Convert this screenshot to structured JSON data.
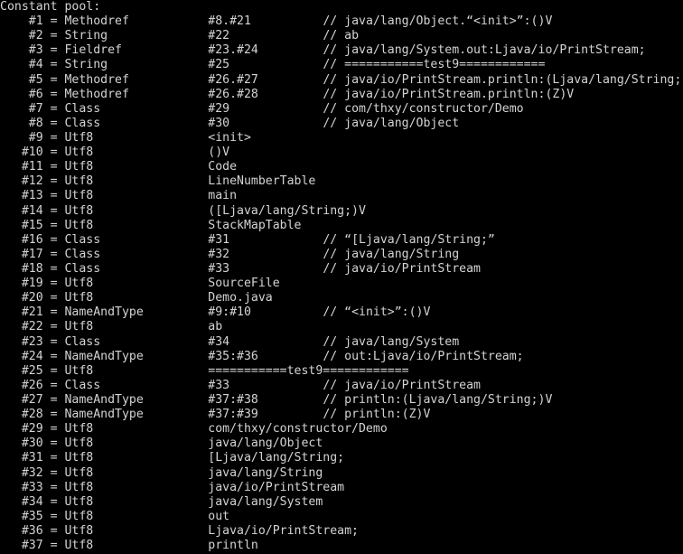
{
  "terminal": {
    "title": "Constant pool:",
    "background_color": "#000000",
    "text_color": "#d4d4d4",
    "columns": {
      "index_width": 6,
      "type_start": 9,
      "value_start": 29,
      "comment_start": 45
    }
  },
  "constant_pool": {
    "heading": "Constant pool:",
    "entries": [
      {
        "index": "#1",
        "eq": "=",
        "type": "Methodref",
        "value": "#8.#21",
        "comment": "// java/lang/Object.“<init>”:()V"
      },
      {
        "index": "#2",
        "eq": "=",
        "type": "String",
        "value": "#22",
        "comment": "// ab"
      },
      {
        "index": "#3",
        "eq": "=",
        "type": "Fieldref",
        "value": "#23.#24",
        "comment": "// java/lang/System.out:Ljava/io/PrintStream;"
      },
      {
        "index": "#4",
        "eq": "=",
        "type": "String",
        "value": "#25",
        "comment": "// ===========test9============"
      },
      {
        "index": "#5",
        "eq": "=",
        "type": "Methodref",
        "value": "#26.#27",
        "comment": "// java/io/PrintStream.println:(Ljava/lang/String;)V"
      },
      {
        "index": "#6",
        "eq": "=",
        "type": "Methodref",
        "value": "#26.#28",
        "comment": "// java/io/PrintStream.println:(Z)V"
      },
      {
        "index": "#7",
        "eq": "=",
        "type": "Class",
        "value": "#29",
        "comment": "// com/thxy/constructor/Demo"
      },
      {
        "index": "#8",
        "eq": "=",
        "type": "Class",
        "value": "#30",
        "comment": "// java/lang/Object"
      },
      {
        "index": "#9",
        "eq": "=",
        "type": "Utf8",
        "value": "<init>",
        "comment": ""
      },
      {
        "index": "#10",
        "eq": "=",
        "type": "Utf8",
        "value": "()V",
        "comment": ""
      },
      {
        "index": "#11",
        "eq": "=",
        "type": "Utf8",
        "value": "Code",
        "comment": ""
      },
      {
        "index": "#12",
        "eq": "=",
        "type": "Utf8",
        "value": "LineNumberTable",
        "comment": ""
      },
      {
        "index": "#13",
        "eq": "=",
        "type": "Utf8",
        "value": "main",
        "comment": ""
      },
      {
        "index": "#14",
        "eq": "=",
        "type": "Utf8",
        "value": "([Ljava/lang/String;)V",
        "comment": ""
      },
      {
        "index": "#15",
        "eq": "=",
        "type": "Utf8",
        "value": "StackMapTable",
        "comment": ""
      },
      {
        "index": "#16",
        "eq": "=",
        "type": "Class",
        "value": "#31",
        "comment": "// “[Ljava/lang/String;”"
      },
      {
        "index": "#17",
        "eq": "=",
        "type": "Class",
        "value": "#32",
        "comment": "// java/lang/String"
      },
      {
        "index": "#18",
        "eq": "=",
        "type": "Class",
        "value": "#33",
        "comment": "// java/io/PrintStream"
      },
      {
        "index": "#19",
        "eq": "=",
        "type": "Utf8",
        "value": "SourceFile",
        "comment": ""
      },
      {
        "index": "#20",
        "eq": "=",
        "type": "Utf8",
        "value": "Demo.java",
        "comment": ""
      },
      {
        "index": "#21",
        "eq": "=",
        "type": "NameAndType",
        "value": "#9:#10",
        "comment": "// “<init>”:()V"
      },
      {
        "index": "#22",
        "eq": "=",
        "type": "Utf8",
        "value": "ab",
        "comment": ""
      },
      {
        "index": "#23",
        "eq": "=",
        "type": "Class",
        "value": "#34",
        "comment": "// java/lang/System"
      },
      {
        "index": "#24",
        "eq": "=",
        "type": "NameAndType",
        "value": "#35:#36",
        "comment": "// out:Ljava/io/PrintStream;"
      },
      {
        "index": "#25",
        "eq": "=",
        "type": "Utf8",
        "value": "===========test9============",
        "comment": ""
      },
      {
        "index": "#26",
        "eq": "=",
        "type": "Class",
        "value": "#33",
        "comment": "// java/io/PrintStream"
      },
      {
        "index": "#27",
        "eq": "=",
        "type": "NameAndType",
        "value": "#37:#38",
        "comment": "// println:(Ljava/lang/String;)V"
      },
      {
        "index": "#28",
        "eq": "=",
        "type": "NameAndType",
        "value": "#37:#39",
        "comment": "// println:(Z)V"
      },
      {
        "index": "#29",
        "eq": "=",
        "type": "Utf8",
        "value": "com/thxy/constructor/Demo",
        "comment": ""
      },
      {
        "index": "#30",
        "eq": "=",
        "type": "Utf8",
        "value": "java/lang/Object",
        "comment": ""
      },
      {
        "index": "#31",
        "eq": "=",
        "type": "Utf8",
        "value": "[Ljava/lang/String;",
        "comment": ""
      },
      {
        "index": "#32",
        "eq": "=",
        "type": "Utf8",
        "value": "java/lang/String",
        "comment": ""
      },
      {
        "index": "#33",
        "eq": "=",
        "type": "Utf8",
        "value": "java/io/PrintStream",
        "comment": ""
      },
      {
        "index": "#34",
        "eq": "=",
        "type": "Utf8",
        "value": "java/lang/System",
        "comment": ""
      },
      {
        "index": "#35",
        "eq": "=",
        "type": "Utf8",
        "value": "out",
        "comment": ""
      },
      {
        "index": "#36",
        "eq": "=",
        "type": "Utf8",
        "value": "Ljava/io/PrintStream;",
        "comment": ""
      },
      {
        "index": "#37",
        "eq": "=",
        "type": "Utf8",
        "value": "println",
        "comment": ""
      }
    ]
  }
}
